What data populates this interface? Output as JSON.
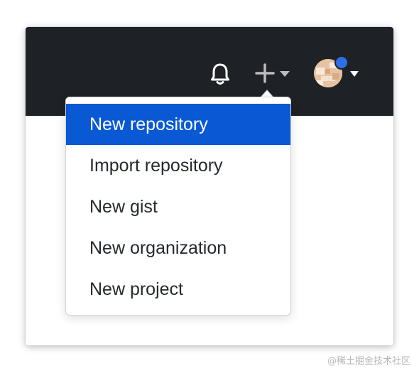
{
  "header": {
    "background_color": "#1e2227",
    "notifications_icon": "bell-icon",
    "create_icon": "plus-icon",
    "create_caret_icon": "caret-down-icon",
    "avatar_caret_icon": "caret-down-icon",
    "avatar_status_dot_color": "#2f6fe6"
  },
  "create_menu": {
    "highlight_color": "#0a59d4",
    "items": [
      {
        "label": "New repository",
        "highlighted": true
      },
      {
        "label": "Import repository",
        "highlighted": false
      },
      {
        "label": "New gist",
        "highlighted": false
      },
      {
        "label": "New organization",
        "highlighted": false
      },
      {
        "label": "New project",
        "highlighted": false
      }
    ]
  },
  "watermark": {
    "text": "@稀土掘金技术社区"
  }
}
